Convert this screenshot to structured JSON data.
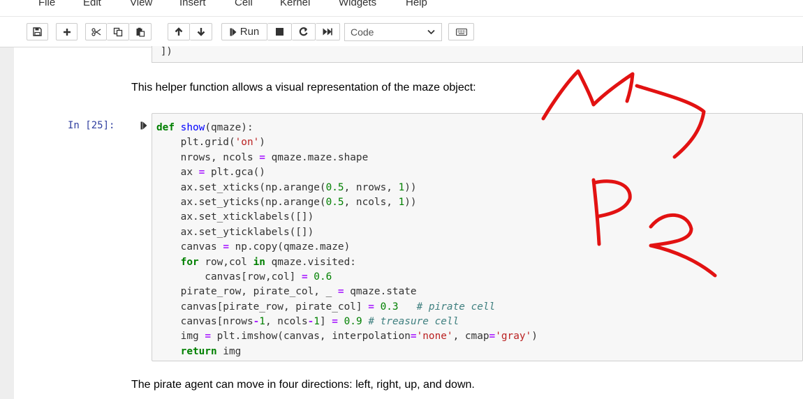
{
  "menubar": {
    "items": [
      "File",
      "Edit",
      "View",
      "Insert",
      "Cell",
      "Kernel",
      "Widgets",
      "Help"
    ]
  },
  "toolbar": {
    "run_label": "Run",
    "cell_type": "Code",
    "icons": [
      "save-icon",
      "plus-icon",
      "scissors-icon",
      "copy-icon",
      "paste-icon",
      "arrow-up-icon",
      "arrow-down-icon",
      "step-forward-icon",
      "stop-icon",
      "restart-icon",
      "fast-forward-icon",
      "keyboard-icon"
    ]
  },
  "notebook": {
    "prev_cell_tail": "])",
    "markdown_1": "This helper function allows a visual representation of the maze object:",
    "cell_prompt": "In [25]:",
    "code_lines": [
      "def show(qmaze):",
      "    plt.grid('on')",
      "    nrows, ncols = qmaze.maze.shape",
      "    ax = plt.gca()",
      "    ax.set_xticks(np.arange(0.5, nrows, 1))",
      "    ax.set_yticks(np.arange(0.5, ncols, 1))",
      "    ax.set_xticklabels([])",
      "    ax.set_yticklabels([])",
      "    canvas = np.copy(qmaze.maze)",
      "    for row,col in qmaze.visited:",
      "        canvas[row,col] = 0.6",
      "    pirate_row, pirate_col, _ = qmaze.state",
      "    canvas[pirate_row, pirate_col] = 0.3   # pirate cell",
      "    canvas[nrows-1, ncols-1] = 0.9 # treasure cell",
      "    img = plt.imshow(canvas, interpolation='none', cmap='gray')",
      "    return img"
    ],
    "markdown_2": "The pirate agent can move in four directions: left, right, up, and down."
  },
  "colors": {
    "ink": "#e21212",
    "prompt": "#303f9f",
    "keyword": "#008000",
    "string": "#ba2121",
    "comment": "#408080"
  }
}
